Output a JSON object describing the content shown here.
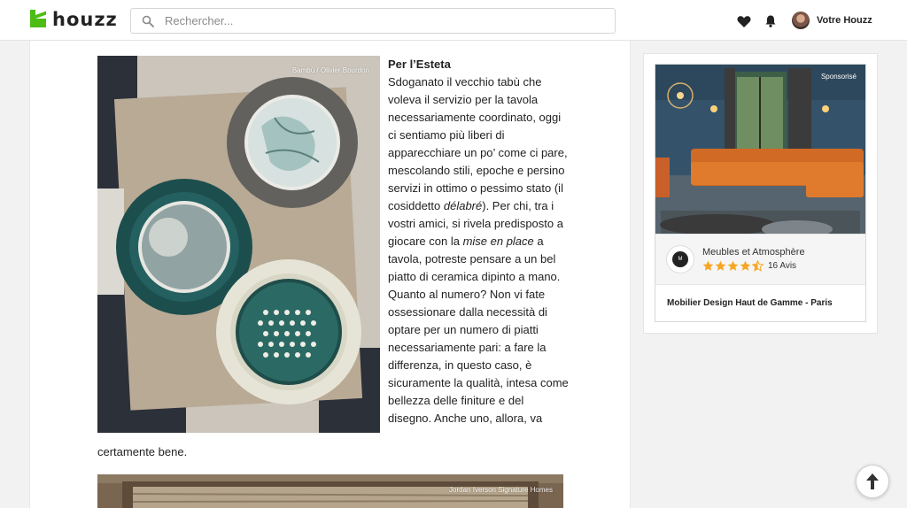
{
  "header": {
    "logo_text": "houzz",
    "search_placeholder": "Rechercher...",
    "account_label": "Votre Houzz",
    "icons": [
      "search-icon",
      "heart-icon",
      "bell-icon",
      "avatar"
    ]
  },
  "article": {
    "photo1_credit": "Bambù / Olivier Bourdon",
    "heading": "Per l’Esteta",
    "paragraph": {
      "part1": "Sdoganato il vecchio tabù che voleva il servizio per la tavola necessariamente coordinato, oggi ci sentiamo più liberi di apparecchiare un po’ come ci pare, mescolando stili, epoche e persino servizi in ottimo o pessimo stato (il cosiddetto ",
      "em1": "délabré",
      "part2": "). Per chi, tra i vostri amici, si rivela predisposto a giocare con la ",
      "em2": "mise en place",
      "part3": " a tavola, potreste pensare a un bel piatto di ceramica dipinto a mano. Quanto al numero? Non vi fate ossessionare dalla necessità di optare per un numero di piatti necessariamente pari: a fare la differenza, in questo caso, è sicuramente la qualità, intesa come bellezza delle finiture e del disegno. Anche uno, allora, va",
      "tail": "certamente bene."
    },
    "photo2_credit": "Jordan Iverson Signature Homes"
  },
  "ad": {
    "sponsored_label": "Sponsorisé",
    "pro_name": "Meubles et Atmosphère",
    "rating": 4.5,
    "rating_max": 5,
    "reviews_label": "16 Avis",
    "title": "Mobilier Design Haut de Gamme - Paris",
    "star_color": "#f5a623"
  },
  "colors": {
    "brand": "#4dbc15"
  }
}
